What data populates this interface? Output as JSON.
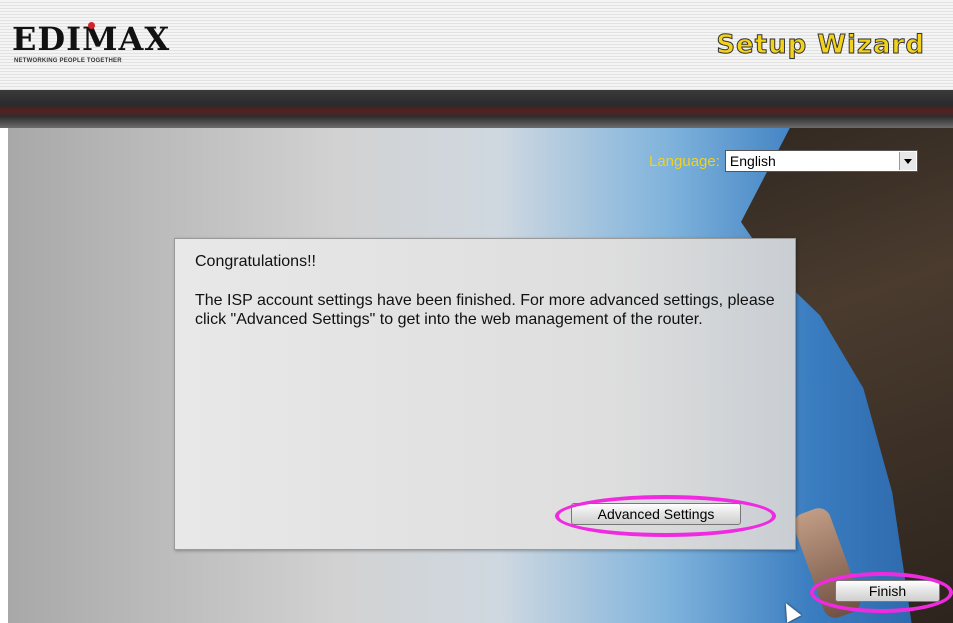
{
  "header": {
    "logo_text": "EDIMAX",
    "logo_tagline": "NETWORKING PEOPLE TOGETHER",
    "title": "Setup Wizard"
  },
  "language": {
    "label": "Language:",
    "selected": "English"
  },
  "dialog": {
    "heading": "Congratulations!!",
    "message": "The ISP account settings have been finished. For more advanced settings, please click \"Advanced Settings\" to get into the web management of the router.",
    "advanced_button": "Advanced Settings"
  },
  "footer": {
    "finish_button": "Finish"
  },
  "colors": {
    "highlight_ring": "#ef2ae0",
    "title_yellow": "#f2d21a"
  }
}
